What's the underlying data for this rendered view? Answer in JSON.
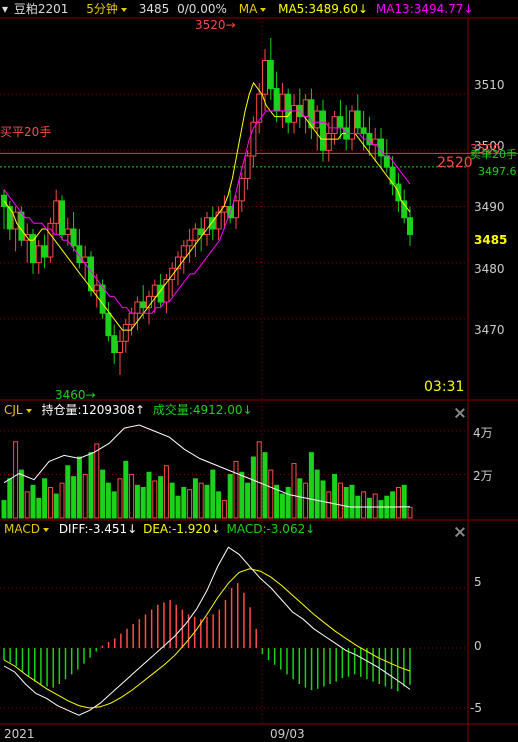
{
  "header": {
    "symbol": "豆粕2201",
    "period": "5分钟",
    "price": "3485",
    "change": "0/0.00%",
    "indicator": "MA",
    "ma5": "MA5:3489.60↓",
    "ma13": "MA13:3494.77↓"
  },
  "main_chart": {
    "price_axis": [
      "3510",
      "3500",
      "3490",
      "3480",
      "3470"
    ],
    "current_price": "3485",
    "high_marker": "3520",
    "low_marker": "3460",
    "buy_close_label": "买平20手",
    "sell_close_price": "3500",
    "sell_close_label": "卖单20手",
    "sell_close_value": "3497.6",
    "order_level": "2520",
    "timer": "03:31"
  },
  "volume_panel": {
    "name": "CJL",
    "open_interest": "持仓量:1209308↑",
    "volume": "成交量:4912.00↓",
    "axis": [
      "4万",
      "2万"
    ]
  },
  "macd_panel": {
    "name": "MACD",
    "diff": "DIFF:-3.451↓",
    "dea": "DEA:-1.920↓",
    "macd": "MACD:-3.062↓",
    "axis": [
      "5",
      "0",
      "-5"
    ]
  },
  "time_axis": [
    "2021",
    "09/03"
  ],
  "colors": {
    "up": "#ff4a4a",
    "down": "#19d219",
    "ma5": "#ffff00",
    "ma13": "#ff00ff",
    "diff_line": "#ffffff",
    "dea_line": "#ffff00"
  },
  "chart_data": [
    {
      "type": "candlestick",
      "title": "豆粕2201 5分钟",
      "ylim": [
        3460,
        3520
      ],
      "series": [
        {
          "name": "MA5",
          "values": [
            3491,
            3490,
            3489,
            3487,
            3486,
            3485,
            3484,
            3484,
            3485,
            3486,
            3486,
            3485,
            3484,
            3483,
            3482,
            3481,
            3480,
            3479,
            3478,
            3477,
            3476,
            3475,
            3474,
            3473,
            3472,
            3471,
            3470,
            3469,
            3468,
            3468,
            3468,
            3469,
            3470,
            3471,
            3472,
            3473,
            3474,
            3475,
            3476,
            3477,
            3478,
            3479,
            3480,
            3481,
            3482,
            3483,
            3484,
            3485,
            3486,
            3487,
            3488,
            3489,
            3490,
            3492,
            3495,
            3499,
            3503,
            3507,
            3510,
            3512,
            3511,
            3510,
            3508,
            3507,
            3506,
            3506,
            3506,
            3506,
            3507,
            3507,
            3507,
            3506,
            3505,
            3504,
            3503,
            3502,
            3502,
            3502,
            3502,
            3502,
            3503,
            3503,
            3503,
            3503,
            3502,
            3501,
            3500,
            3499,
            3498,
            3497,
            3496,
            3495,
            3494,
            3493,
            3491,
            3490,
            3489
          ]
        },
        {
          "name": "MA13",
          "values": [
            3493,
            3492,
            3491,
            3490,
            3489,
            3488,
            3488,
            3487,
            3487,
            3487,
            3486,
            3486,
            3485,
            3485,
            3484,
            3484,
            3483,
            3482,
            3481,
            3480,
            3479,
            3478,
            3477,
            3476,
            3475,
            3474,
            3474,
            3473,
            3472,
            3472,
            3471,
            3471,
            3471,
            3471,
            3471,
            3471,
            3472,
            3472,
            3473,
            3473,
            3474,
            3475,
            3476,
            3477,
            3478,
            3478,
            3479,
            3480,
            3481,
            3482,
            3483,
            3484,
            3486,
            3488,
            3490,
            3493,
            3496,
            3499,
            3502,
            3504,
            3505,
            3506,
            3507,
            3507,
            3507,
            3507,
            3507,
            3507,
            3507,
            3507,
            3507,
            3506,
            3506,
            3505,
            3505,
            3505,
            3505,
            3504,
            3504,
            3504,
            3504,
            3503,
            3503,
            3503,
            3503,
            3502,
            3502,
            3501,
            3501,
            3500,
            3499,
            3499,
            3498,
            3497,
            3496,
            3495,
            3494
          ]
        }
      ],
      "candles": [
        [
          3492,
          3493,
          3486,
          3490
        ],
        [
          3490,
          3491,
          3484,
          3486
        ],
        [
          3486,
          3490,
          3482,
          3489
        ],
        [
          3489,
          3490,
          3483,
          3484
        ],
        [
          3484,
          3487,
          3480,
          3485
        ],
        [
          3485,
          3486,
          3478,
          3480
        ],
        [
          3480,
          3484,
          3478,
          3483
        ],
        [
          3483,
          3485,
          3479,
          3481
        ],
        [
          3481,
          3488,
          3480,
          3487
        ],
        [
          3487,
          3493,
          3485,
          3491
        ],
        [
          3491,
          3492,
          3484,
          3485
        ],
        [
          3485,
          3488,
          3483,
          3486
        ],
        [
          3486,
          3489,
          3482,
          3483
        ],
        [
          3483,
          3486,
          3479,
          3480
        ],
        [
          3480,
          3483,
          3477,
          3481
        ],
        [
          3481,
          3482,
          3474,
          3475
        ],
        [
          3475,
          3478,
          3472,
          3476
        ],
        [
          3476,
          3477,
          3470,
          3471
        ],
        [
          3471,
          3473,
          3466,
          3467
        ],
        [
          3467,
          3469,
          3462,
          3464
        ],
        [
          3464,
          3468,
          3460,
          3466
        ],
        [
          3466,
          3470,
          3464,
          3469
        ],
        [
          3469,
          3472,
          3467,
          3471
        ],
        [
          3471,
          3474,
          3468,
          3473
        ],
        [
          3473,
          3476,
          3470,
          3472
        ],
        [
          3472,
          3475,
          3469,
          3474
        ],
        [
          3474,
          3477,
          3471,
          3476
        ],
        [
          3476,
          3478,
          3472,
          3473
        ],
        [
          3473,
          3478,
          3471,
          3477
        ],
        [
          3477,
          3480,
          3474,
          3479
        ],
        [
          3479,
          3482,
          3476,
          3481
        ],
        [
          3481,
          3484,
          3478,
          3483
        ],
        [
          3483,
          3486,
          3480,
          3484
        ],
        [
          3484,
          3487,
          3481,
          3486
        ],
        [
          3486,
          3488,
          3482,
          3485
        ],
        [
          3485,
          3489,
          3483,
          3488
        ],
        [
          3488,
          3490,
          3484,
          3486
        ],
        [
          3486,
          3490,
          3484,
          3489
        ],
        [
          3489,
          3492,
          3486,
          3490
        ],
        [
          3490,
          3493,
          3487,
          3488
        ],
        [
          3488,
          3492,
          3486,
          3491
        ],
        [
          3491,
          3496,
          3489,
          3495
        ],
        [
          3495,
          3500,
          3493,
          3499
        ],
        [
          3499,
          3506,
          3497,
          3505
        ],
        [
          3505,
          3512,
          3503,
          3510
        ],
        [
          3510,
          3518,
          3507,
          3516
        ],
        [
          3516,
          3520,
          3509,
          3511
        ],
        [
          3511,
          3514,
          3505,
          3507
        ],
        [
          3507,
          3512,
          3504,
          3510
        ],
        [
          3510,
          3511,
          3503,
          3505
        ],
        [
          3505,
          3510,
          3503,
          3508
        ],
        [
          3508,
          3511,
          3504,
          3506
        ],
        [
          3506,
          3510,
          3503,
          3509
        ],
        [
          3509,
          3511,
          3502,
          3504
        ],
        [
          3504,
          3508,
          3500,
          3507
        ],
        [
          3507,
          3509,
          3498,
          3500
        ],
        [
          3500,
          3505,
          3498,
          3503
        ],
        [
          3503,
          3507,
          3501,
          3506
        ],
        [
          3506,
          3509,
          3502,
          3504
        ],
        [
          3504,
          3508,
          3500,
          3502
        ],
        [
          3502,
          3508,
          3500,
          3507
        ],
        [
          3507,
          3510,
          3503,
          3504
        ],
        [
          3504,
          3507,
          3500,
          3503
        ],
        [
          3503,
          3506,
          3499,
          3501
        ],
        [
          3501,
          3504,
          3498,
          3502
        ],
        [
          3502,
          3504,
          3497,
          3499
        ],
        [
          3499,
          3502,
          3496,
          3497
        ],
        [
          3497,
          3499,
          3492,
          3494
        ],
        [
          3494,
          3496,
          3489,
          3491
        ],
        [
          3491,
          3493,
          3487,
          3488
        ],
        [
          3488,
          3490,
          3483,
          3485
        ]
      ]
    },
    {
      "type": "bar",
      "title": "CJL",
      "ylim": [
        0,
        45000
      ],
      "series": [
        {
          "name": "成交量",
          "values": [
            8000,
            18000,
            35000,
            22000,
            12000,
            15000,
            9000,
            18000,
            14000,
            11000,
            16000,
            24000,
            19000,
            28000,
            20000,
            30000,
            34000,
            22000,
            16000,
            12000,
            18000,
            26000,
            20000,
            15000,
            14000,
            21000,
            17000,
            19000,
            24000,
            16000,
            10000,
            14000,
            13000,
            18000,
            16000,
            15000,
            22000,
            12000,
            8000,
            20000,
            26000,
            21000,
            16000,
            28000,
            35000,
            30000,
            22000,
            15000,
            11000,
            14000,
            25000,
            18000,
            16000,
            30000,
            22000,
            17000,
            12000,
            20000,
            16000,
            14000,
            15000,
            10000,
            12000,
            9000,
            11000,
            8000,
            10000,
            12000,
            14000,
            15000,
            4912
          ]
        },
        {
          "name": "持仓量",
          "values": [
            1210100,
            1210400,
            1210200,
            1210800,
            1211000,
            1210900,
            1211100,
            1211400,
            1211900,
            1212000,
            1211800,
            1211600,
            1211200,
            1210900,
            1210700,
            1210500,
            1210300,
            1210100,
            1209900,
            1209700,
            1209600,
            1209500,
            1209400,
            1209300,
            1209300,
            1209300,
            1209300,
            1209308
          ]
        }
      ]
    },
    {
      "type": "bar",
      "title": "MACD",
      "ylim": [
        -6,
        9
      ],
      "series": [
        {
          "name": "MACD",
          "values": [
            -1,
            -1.2,
            -1.5,
            -2,
            -2.4,
            -2.8,
            -3,
            -3.2,
            -3.3,
            -3,
            -2.6,
            -2.2,
            -1.8,
            -1.3,
            -0.8,
            -0.3,
            0.2,
            0.5,
            0.8,
            1.2,
            1.6,
            2,
            2.4,
            2.8,
            3.2,
            3.6,
            3.8,
            4,
            3.6,
            3.2,
            2.8,
            2.6,
            2.4,
            2.6,
            2.8,
            3.2,
            4,
            5,
            5.4,
            4.6,
            3.4,
            1.6,
            -0.5,
            -1,
            -1.4,
            -1.8,
            -2.2,
            -2.6,
            -3,
            -3.3,
            -3.5,
            -3.4,
            -3.2,
            -3,
            -2.8,
            -2.5,
            -2.4,
            -2.2,
            -2.4,
            -2.6,
            -2.8,
            -3,
            -3.2,
            -3.4,
            -3.6,
            -3.2,
            -3.062
          ]
        },
        {
          "name": "DIFF",
          "values": [
            -1.5,
            -2,
            -3,
            -3.8,
            -4.2,
            -4.8,
            -5.2,
            -5.6,
            -5.2,
            -4.6,
            -3.8,
            -3,
            -2.2,
            -1.4,
            -0.6,
            0.2,
            1,
            2,
            3.2,
            4.8,
            6.8,
            8.4,
            7.8,
            6.8,
            5.8,
            5,
            4,
            3,
            2.4,
            1.6,
            1,
            0.4,
            -0.2,
            -0.6,
            -1.1,
            -1.6,
            -2.2,
            -2.8,
            -3.451
          ]
        },
        {
          "name": "DEA",
          "values": [
            -1,
            -1.5,
            -2.2,
            -2.8,
            -3.4,
            -3.9,
            -4.4,
            -4.8,
            -5,
            -4.9,
            -4.6,
            -4.1,
            -3.5,
            -2.8,
            -2.1,
            -1.4,
            -0.6,
            0.4,
            1.5,
            2.8,
            4.2,
            5.4,
            6.3,
            6.6,
            6.4,
            5.9,
            5.2,
            4.4,
            3.6,
            2.8,
            2.1,
            1.4,
            0.8,
            0.2,
            -0.3,
            -0.8,
            -1.2,
            -1.6,
            -1.92
          ]
        }
      ]
    }
  ]
}
